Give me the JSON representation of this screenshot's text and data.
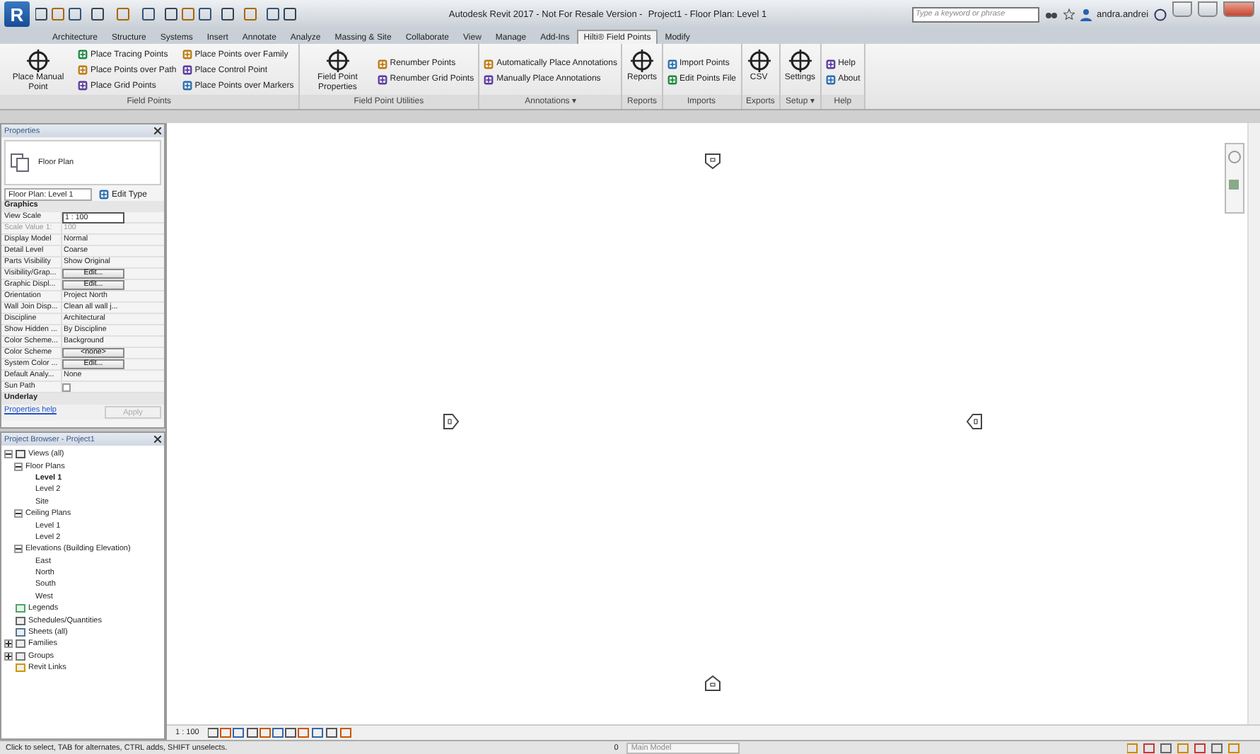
{
  "title_bar": {
    "app_button": "R",
    "title": "Autodesk Revit 2017 - Not For Resale Version -",
    "document": "Project1 - Floor Plan: Level 1",
    "search": {
      "placeholder": "Type a keyword or phrase"
    },
    "user": "andra.andrei"
  },
  "tabs": [
    {
      "label": "Architecture",
      "selected": false
    },
    {
      "label": "Structure",
      "selected": false
    },
    {
      "label": "Systems",
      "selected": false
    },
    {
      "label": "Insert",
      "selected": false
    },
    {
      "label": "Annotate",
      "selected": false
    },
    {
      "label": "Analyze",
      "selected": false
    },
    {
      "label": "Massing & Site",
      "selected": false
    },
    {
      "label": "Collaborate",
      "selected": false
    },
    {
      "label": "View",
      "selected": false
    },
    {
      "label": "Manage",
      "selected": false
    },
    {
      "label": "Add-Ins",
      "selected": false
    },
    {
      "label": "Hilti® Field Points",
      "selected": true
    },
    {
      "label": "Modify",
      "selected": false
    }
  ],
  "ribbon": [
    {
      "label": "Field Points",
      "columns": [
        [
          {
            "label": "Place Manual Point",
            "kind": "large"
          }
        ],
        [
          {
            "label": "Place Tracing Points",
            "kind": "small"
          },
          {
            "label": "Place Points over Path",
            "kind": "small"
          },
          {
            "label": "Place Grid Points",
            "kind": "small"
          }
        ],
        [
          {
            "label": "Place Points over Family",
            "kind": "small"
          },
          {
            "label": "Place Control Point",
            "kind": "small"
          },
          {
            "label": "Place Points over Markers",
            "kind": "small"
          }
        ]
      ]
    },
    {
      "label": "Field Point Utilities",
      "columns": [
        [
          {
            "label": "Field Point Properties",
            "kind": "large"
          }
        ],
        [
          {
            "label": "Renumber Points",
            "kind": "small"
          },
          {
            "label": "Renumber Grid Points",
            "kind": "small"
          }
        ]
      ]
    },
    {
      "label": "Annotations ▾",
      "columns": [
        [
          {
            "label": "Automatically Place Annotations",
            "kind": "small"
          },
          {
            "label": "Manually Place Annotations",
            "kind": "small"
          }
        ]
      ]
    },
    {
      "label": "Reports",
      "columns": [
        [
          {
            "label": "Reports",
            "kind": "large"
          }
        ]
      ]
    },
    {
      "label": "Imports",
      "columns": [
        [
          {
            "label": "Import Points",
            "kind": "small"
          },
          {
            "label": "Edit Points File",
            "kind": "small"
          }
        ]
      ]
    },
    {
      "label": "Exports",
      "columns": [
        [
          {
            "label": "CSV",
            "kind": "large"
          }
        ]
      ]
    },
    {
      "label": "Setup ▾",
      "columns": [
        [
          {
            "label": "Settings",
            "kind": "large"
          }
        ]
      ]
    },
    {
      "label": "Help",
      "columns": [
        [
          {
            "label": "Help",
            "kind": "small"
          },
          {
            "label": "About",
            "kind": "small"
          }
        ]
      ]
    }
  ],
  "properties": {
    "title": "Properties",
    "type_name": "Floor Plan",
    "instance": "Floor Plan: Level 1",
    "edit_type": "Edit Type",
    "group": "Graphics",
    "rows": [
      {
        "name": "View Scale",
        "value": "1 : 100",
        "kind": "field",
        "disabled": false
      },
      {
        "name": "Scale Value  1:",
        "value": "100",
        "kind": "text",
        "disabled": true
      },
      {
        "name": "Display Model",
        "value": "Normal",
        "kind": "text",
        "disabled": false
      },
      {
        "name": "Detail Level",
        "value": "Coarse",
        "kind": "text",
        "disabled": false
      },
      {
        "name": "Parts Visibility",
        "value": "Show Original",
        "kind": "text",
        "disabled": false
      },
      {
        "name": "Visibility/Grap...",
        "value": "Edit...",
        "kind": "button",
        "disabled": false
      },
      {
        "name": "Graphic Displ...",
        "value": "Edit...",
        "kind": "button",
        "disabled": false
      },
      {
        "name": "Orientation",
        "value": "Project North",
        "kind": "text",
        "disabled": false
      },
      {
        "name": "Wall Join Disp...",
        "value": "Clean all wall j...",
        "kind": "text",
        "disabled": false
      },
      {
        "name": "Discipline",
        "value": "Architectural",
        "kind": "text",
        "disabled": false
      },
      {
        "name": "Show Hidden ...",
        "value": "By Discipline",
        "kind": "text",
        "disabled": false
      },
      {
        "name": "Color Scheme...",
        "value": "Background",
        "kind": "text",
        "disabled": false
      },
      {
        "name": "Color Scheme",
        "value": "<none>",
        "kind": "button",
        "disabled": false
      },
      {
        "name": "System Color ...",
        "value": "Edit...",
        "kind": "button",
        "disabled": false
      },
      {
        "name": "Default Analy...",
        "value": "None",
        "kind": "text",
        "disabled": false
      },
      {
        "name": "Sun Path",
        "kind": "checkbox",
        "checked": false,
        "disabled": false
      }
    ],
    "next_group": "Underlay",
    "help_link": "Properties help",
    "apply": "Apply"
  },
  "browser": {
    "title": "Project Browser - Project1",
    "tree": [
      {
        "label": "Views (all)",
        "kind": "views",
        "expanded": true,
        "selected": false,
        "children": [
          {
            "label": "Floor Plans",
            "expanded": true,
            "selected": false,
            "children": [
              {
                "label": "Level 1",
                "selected": true
              },
              {
                "label": "Level 2",
                "selected": false
              },
              {
                "label": "Site",
                "selected": false
              }
            ]
          },
          {
            "label": "Ceiling Plans",
            "expanded": true,
            "selected": false,
            "children": [
              {
                "label": "Level 1",
                "selected": false
              },
              {
                "label": "Level 2",
                "selected": false
              }
            ]
          },
          {
            "label": "Elevations (Building Elevation)",
            "expanded": true,
            "selected": false,
            "children": [
              {
                "label": "East",
                "selected": false
              },
              {
                "label": "North",
                "selected": false
              },
              {
                "label": "South",
                "selected": false
              },
              {
                "label": "West",
                "selected": false
              }
            ]
          }
        ]
      },
      {
        "label": "Legends",
        "kind": "legends",
        "selected": false
      },
      {
        "label": "Schedules/Quantities",
        "kind": "schedules",
        "selected": false
      },
      {
        "label": "Sheets (all)",
        "kind": "sheets",
        "selected": false
      },
      {
        "label": "Families",
        "kind": "families",
        "expanded": false,
        "selected": false
      },
      {
        "label": "Groups",
        "kind": "groups",
        "expanded": false,
        "selected": false
      },
      {
        "label": "Revit Links",
        "kind": "links",
        "selected": false
      }
    ]
  },
  "view_bar": {
    "scale": "1 : 100"
  },
  "status_bar": {
    "message": "Click to select, TAB for alternates, CTRL adds, SHIFT unselects.",
    "count": "0",
    "model": "Main Model"
  }
}
